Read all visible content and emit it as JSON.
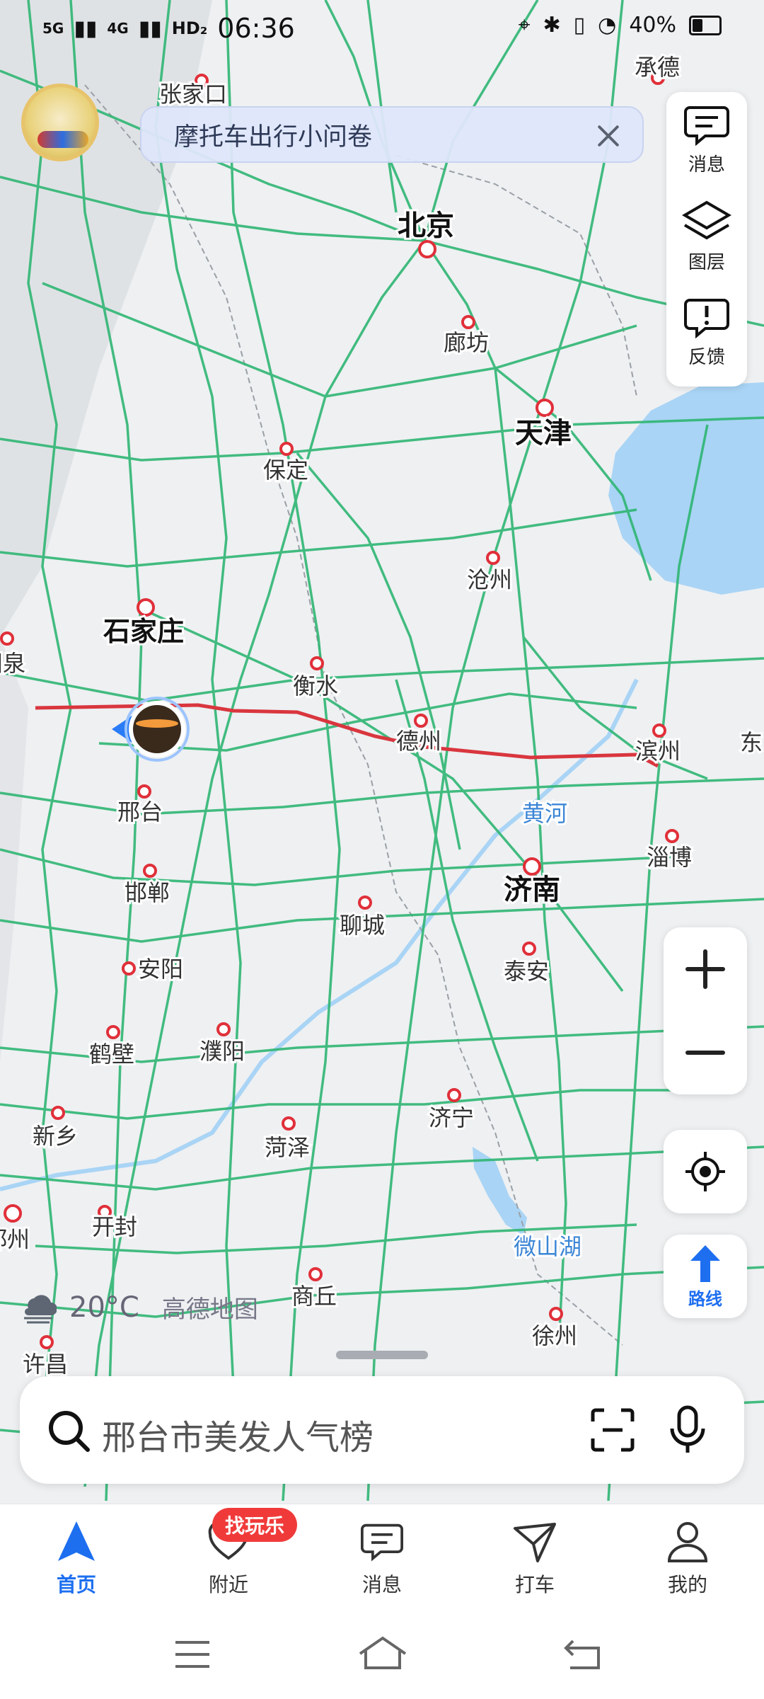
{
  "status_bar": {
    "signal_1": "5G",
    "signal_2": "4G",
    "hd": "HD₂",
    "time": "06:36",
    "battery": "40%"
  },
  "banner": {
    "text": "摩托车出行小问卷"
  },
  "side_panel": {
    "items": [
      {
        "label": "消息",
        "icon": "message-icon"
      },
      {
        "label": "图层",
        "icon": "layers-icon"
      },
      {
        "label": "反馈",
        "icon": "feedback-icon"
      }
    ]
  },
  "map": {
    "labels": [
      {
        "text": "张家口"
      },
      {
        "text": "承德"
      },
      {
        "text": "北京"
      },
      {
        "text": "廊坊"
      },
      {
        "text": "天津"
      },
      {
        "text": "保定"
      },
      {
        "text": "沧州"
      },
      {
        "text": "石家庄"
      },
      {
        "text": "阳泉"
      },
      {
        "text": "衡水"
      },
      {
        "text": "德州"
      },
      {
        "text": "滨州"
      },
      {
        "text": "东"
      },
      {
        "text": "邢台"
      },
      {
        "text": "黄河"
      },
      {
        "text": "济南"
      },
      {
        "text": "淄博"
      },
      {
        "text": "邯郸"
      },
      {
        "text": "聊城"
      },
      {
        "text": "安阳"
      },
      {
        "text": "泰安"
      },
      {
        "text": "鹤壁"
      },
      {
        "text": "濮阳"
      },
      {
        "text": "济宁"
      },
      {
        "text": "新乡"
      },
      {
        "text": "菏泽"
      },
      {
        "text": "郑州"
      },
      {
        "text": "开封"
      },
      {
        "text": "微山湖"
      },
      {
        "text": "商丘"
      },
      {
        "text": "徐州"
      },
      {
        "text": "许昌"
      }
    ]
  },
  "route_button": {
    "label": "路线"
  },
  "weather": {
    "temp": "20°C",
    "brand": "高德地图"
  },
  "search": {
    "placeholder": "邢台市美发人气榜"
  },
  "tabs": [
    {
      "label": "首页",
      "active": true
    },
    {
      "label": "附近",
      "badge": "找玩乐"
    },
    {
      "label": "消息"
    },
    {
      "label": "打车"
    },
    {
      "label": "我的"
    }
  ],
  "colors": {
    "accent": "#1d6ff0",
    "road": "#2fb673",
    "route": "#d9363e",
    "water": "#a9d4f5"
  }
}
